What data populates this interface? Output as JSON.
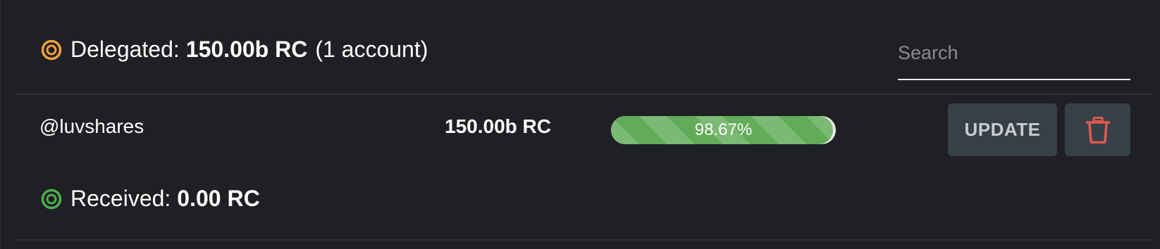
{
  "delegated": {
    "icon": "ring-icon",
    "color": "#f0a040",
    "label": "Delegated:",
    "value": "150.00b RC",
    "count": "(1 account)"
  },
  "search": {
    "placeholder": "Search",
    "value": ""
  },
  "rows": [
    {
      "account": "@luvshares",
      "amount": "150.00b RC",
      "progress_percent": 98.67,
      "progress_label": "98.67%",
      "update_label": "UPDATE",
      "delete_icon": "trash-icon"
    }
  ],
  "received": {
    "icon": "ring-icon",
    "color": "#4caf50",
    "label": "Received:",
    "value": "0.00 RC"
  },
  "colors": {
    "background": "#1f2024",
    "progress_fill": "#62ab58",
    "button_bg": "#374047",
    "delete_icon": "#e05a4e"
  }
}
